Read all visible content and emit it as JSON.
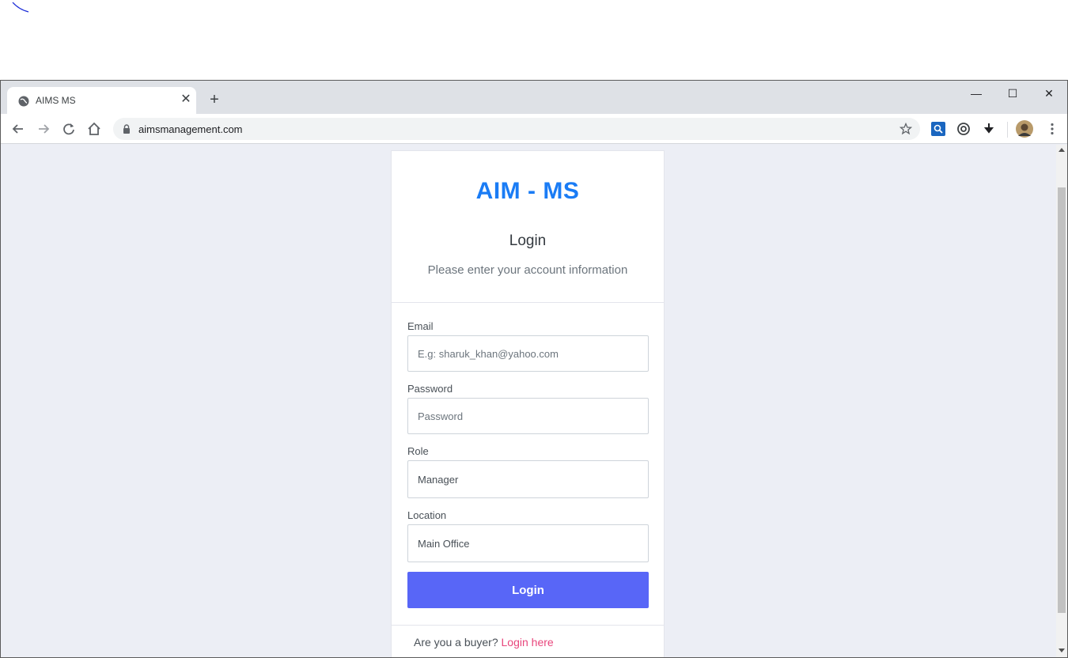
{
  "browser": {
    "tab_title": "AIMS MS",
    "tab_close": "✕",
    "new_tab": "+",
    "url": "aimsmanagement.com",
    "window_controls": {
      "minimize": "—",
      "maximize": "☐",
      "close": "✕"
    }
  },
  "icons": [
    "globe-icon",
    "back-icon",
    "forward-icon",
    "reload-icon",
    "home-icon",
    "lock-icon",
    "star-icon",
    "search-extension-icon",
    "link-extension-icon",
    "download-icon",
    "avatar",
    "menu-icon"
  ],
  "login_card": {
    "brand": "AIM - MS",
    "title": "Login",
    "subtitle": "Please enter your account information",
    "email": {
      "label": "Email",
      "placeholder": "E.g: sharuk_khan@yahoo.com"
    },
    "password": {
      "label": "Password",
      "placeholder": "Password"
    },
    "role": {
      "label": "Role",
      "value": "Manager"
    },
    "location": {
      "label": "Location",
      "value": "Main Office"
    },
    "submit_label": "Login",
    "buyer_prompt": "Are you a buyer?",
    "buyer_link": "Login here"
  },
  "colors": {
    "brand": "#1a7cf5",
    "button": "#5866f7",
    "link": "#e8467c",
    "background": "#eceef5"
  }
}
